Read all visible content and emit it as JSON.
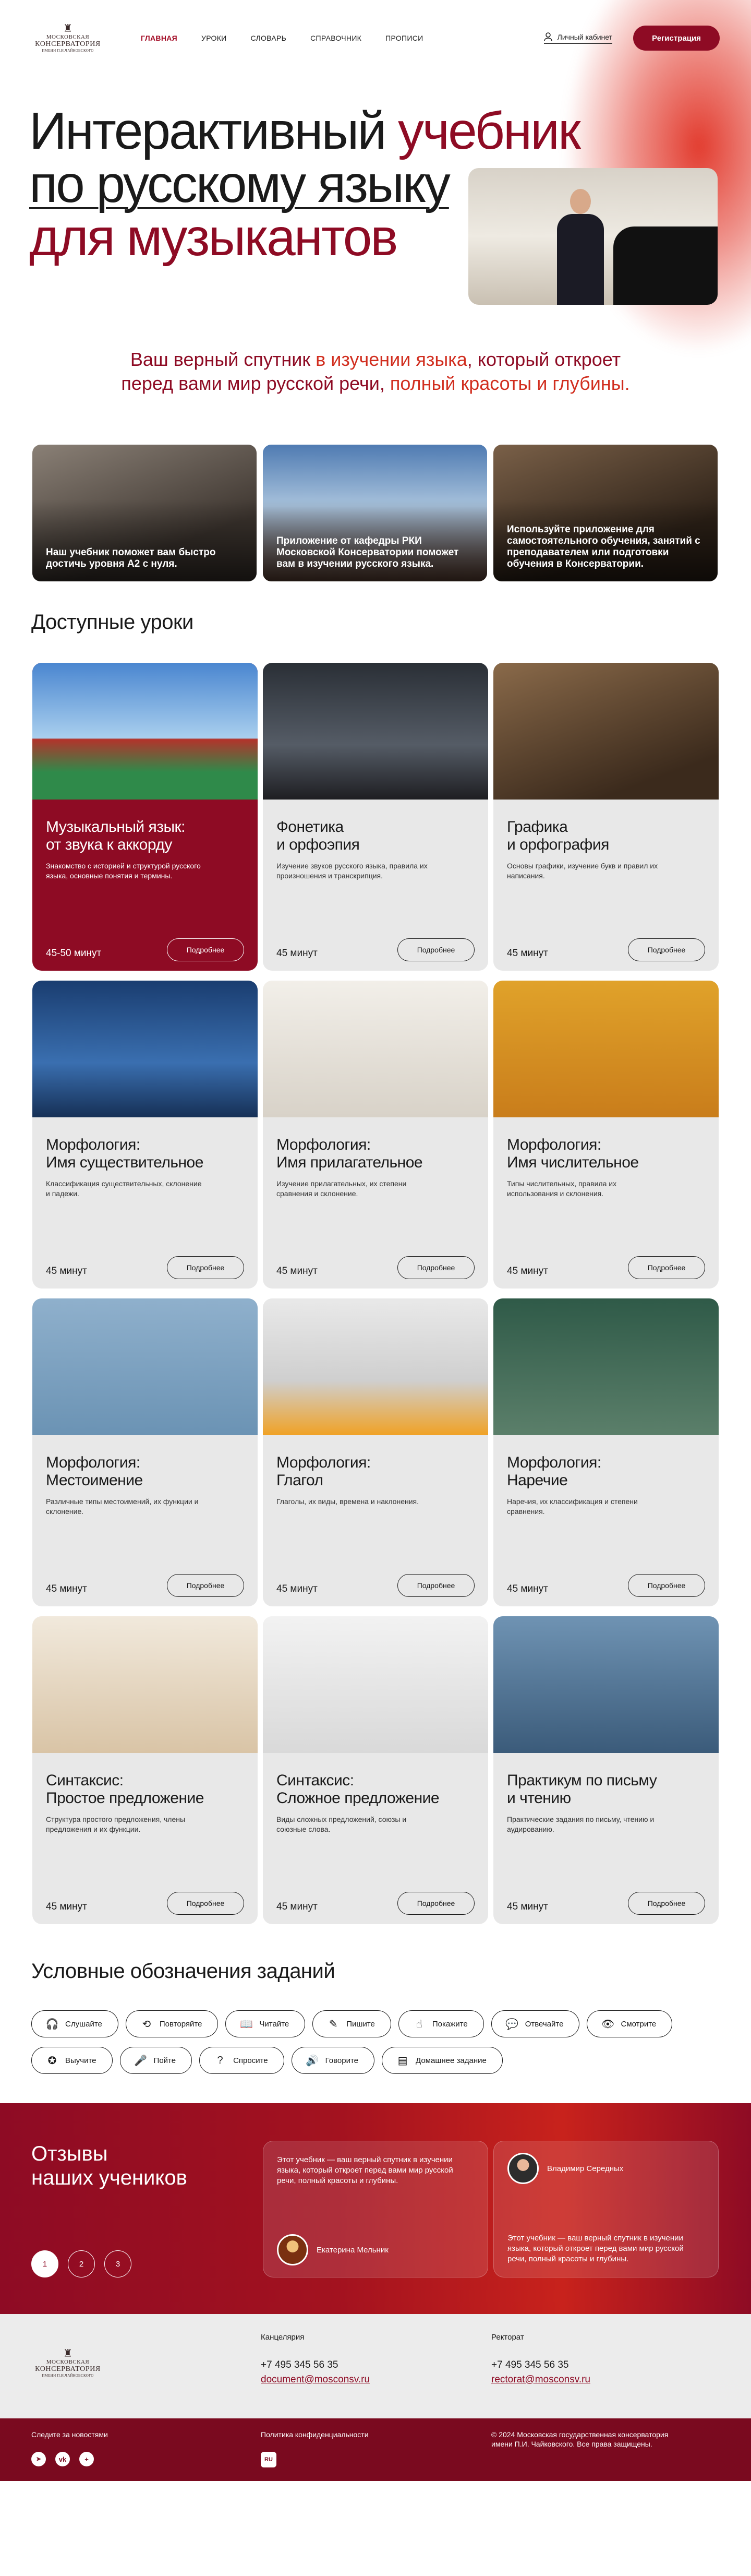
{
  "header": {
    "logo": {
      "line1": "МОСКОВСКАЯ",
      "line2": "КОНСЕРВАТОРИЯ",
      "line3": "ИМЕНИ П.И.ЧАЙКОВСКОГО"
    },
    "nav": [
      "ГЛАВНАЯ",
      "УРОКИ",
      "СЛОВАРЬ",
      "СПРАВОЧНИК",
      "ПРОПИСИ"
    ],
    "active_nav": "ГЛАВНАЯ",
    "cabinet_label": "Личный кабинет",
    "register_label": "Регистрация"
  },
  "hero": {
    "title_line1_a": "Интерактивный ",
    "title_line1_b": "учебник",
    "title_line2": "по русскому языку",
    "title_line3": "для музыкантов",
    "tagline_1": "Ваш верный спутник ",
    "tagline_2": "в изучении языка",
    "tagline_3": ", который откроет",
    "tagline_4": "перед вами мир русской речи, ",
    "tagline_5": "полный красоты и глубины."
  },
  "features": [
    {
      "text": "Наш учебник поможет вам быстро достичь уровня А2 с нуля."
    },
    {
      "text": "Приложение от кафедры РКИ Московской Консерватории поможет вам в изучении русского языка."
    },
    {
      "text": "Используйте приложение для самостоятельного обучения, занятий с преподавателем или подготовки обучения в Консерватории."
    }
  ],
  "lessons_title": "Доступные уроки",
  "lessons": [
    {
      "title": "Музыкальный язык:\nот звука к аккорду",
      "desc": "Знакомство с историей и структурой русского языка, основные понятия и термины.",
      "duration": "45-50 минут",
      "more": "Подробнее"
    },
    {
      "title": "Фонетика\nи орфоэпия",
      "desc": "Изучение звуков русского языка, правила их произношения и транскрипция.",
      "duration": "45 минут",
      "more": "Подробнее"
    },
    {
      "title": "Графика\nи орфография",
      "desc": "Основы графики, изучение букв и правил их написания.",
      "duration": "45 минут",
      "more": "Подробнее"
    },
    {
      "title": "Морфология:\nИмя существительное",
      "desc": "Классификация существительных, склонение и падежи.",
      "duration": "45 минут",
      "more": "Подробнее"
    },
    {
      "title": "Морфология:\nИмя прилагательное",
      "desc": "Изучение прилагательных, их степени сравнения и склонение.",
      "duration": "45 минут",
      "more": "Подробнее"
    },
    {
      "title": "Морфология:\nИмя числительное",
      "desc": "Типы числительных, правила их использования и склонения.",
      "duration": "45 минут",
      "more": "Подробнее"
    },
    {
      "title": "Морфология:\nМестоимение",
      "desc": "Различные типы местоимений, их функции и склонение.",
      "duration": "45 минут",
      "more": "Подробнее"
    },
    {
      "title": "Морфология:\nГлагол",
      "desc": "Глаголы, их виды, времена и наклонения.",
      "duration": "45 минут",
      "more": "Подробнее"
    },
    {
      "title": "Морфология:\nНаречие",
      "desc": "Наречия, их классификация и степени сравнения.",
      "duration": "45 минут",
      "more": "Подробнее"
    },
    {
      "title": "Синтаксис:\nПростое предложение",
      "desc": "Структура простого предложения, члены предложения и их функции.",
      "duration": "45 минут",
      "more": "Подробнее"
    },
    {
      "title": "Синтаксис:\nСложное предложение",
      "desc": "Виды сложных предложений, союзы и союзные слова.",
      "duration": "45 минут",
      "more": "Подробнее"
    },
    {
      "title": "Практикум по письму\nи чтению",
      "desc": "Практические задания по письму, чтению и аудированию.",
      "duration": "45 минут",
      "more": "Подробнее"
    }
  ],
  "legend_title": "Условные обозначения заданий",
  "legend": [
    {
      "label": "Слушайте",
      "icon": "headphones-icon",
      "glyph": "🎧"
    },
    {
      "label": "Повторяйте",
      "icon": "repeat-icon",
      "glyph": "⟲"
    },
    {
      "label": "Читайте",
      "icon": "book-icon",
      "glyph": "📖"
    },
    {
      "label": "Пишите",
      "icon": "write-icon",
      "glyph": "✎"
    },
    {
      "label": "Покажите",
      "icon": "point-icon",
      "glyph": "☝"
    },
    {
      "label": "Отвечайте",
      "icon": "chat-icon",
      "glyph": "💬"
    },
    {
      "label": "Смотрите",
      "icon": "eye-icon",
      "glyph": "👁"
    },
    {
      "label": "Выучите",
      "icon": "brain-icon",
      "glyph": "✪"
    },
    {
      "label": "Пойте",
      "icon": "microphone-icon",
      "glyph": "🎤"
    },
    {
      "label": "Спросите",
      "icon": "question-icon",
      "glyph": "?"
    },
    {
      "label": "Говорите",
      "icon": "speaker-icon",
      "glyph": "🔊"
    },
    {
      "label": "Домашнее задание",
      "icon": "homework-icon",
      "glyph": "▤"
    }
  ],
  "reviews": {
    "title_line1": "Отзывы",
    "title_line2": "наших учеников",
    "pages": [
      "1",
      "2",
      "3"
    ],
    "items": [
      {
        "text": "Этот учебник — ваш верный спутник в изучении языка, который откроет перед вами мир русской речи, полный красоты и глубины.",
        "name": "Екатерина Мельник"
      },
      {
        "text": "Этот учебник — ваш верный спутник в изучении языка, который откроет перед вами мир русской речи, полный красоты и глубины.",
        "name": "Владимир Середных"
      }
    ]
  },
  "footer": {
    "office_caption": "Канцелярия",
    "office_phone": "+7 495 345 56 35",
    "office_email": "document@mosconsv.ru",
    "rector_caption": "Ректорат",
    "rector_phone": "+7 495 345 56 35",
    "rector_email": "rectorat@mosconsv.ru",
    "follow": "Следите за новостями",
    "privacy": "Политика конфиденциальности",
    "copyright": "© 2024 Московская государственная консерватория имени П.И. Чайковского. Все права защищены.",
    "social": [
      "telegram-icon",
      "vk-icon",
      "plus-icon"
    ],
    "ru_badge": "RU"
  },
  "colors": {
    "brand": "#8e0b24",
    "accent": "#d12e1f",
    "card_bg": "#e8e8e8"
  }
}
